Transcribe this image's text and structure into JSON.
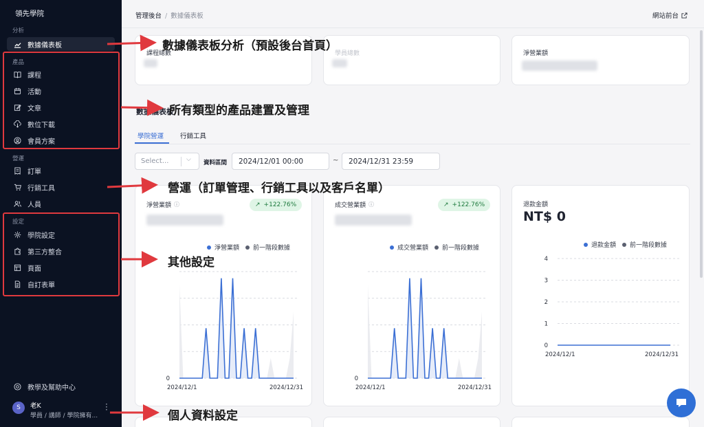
{
  "sidebar": {
    "brand": "領先學院",
    "sections": {
      "analysis": "分析",
      "products": "產品",
      "operations": "營運",
      "settings": "設定"
    },
    "items": {
      "dashboard": "數據儀表板",
      "courses": "課程",
      "events": "活動",
      "articles": "文章",
      "downloads": "數位下載",
      "membership": "會員方案",
      "orders": "訂單",
      "marketing": "行銷工具",
      "people": "人員",
      "school_settings": "學院設定",
      "integrations": "第三方整合",
      "pages": "頁面",
      "custom_forms": "自訂表單"
    },
    "help": "教學及幫助中心",
    "user": {
      "initial": "S",
      "name": "老K",
      "role": "學員 / 講師 / 學院擁有..."
    }
  },
  "topbar": {
    "breadcrumb_root": "管理後台",
    "breadcrumb_sep": "/",
    "breadcrumb_current": "數據儀表板",
    "front_link": "網站前台"
  },
  "summary_cards": {
    "courses": "課程總數",
    "students": "學員總數",
    "net_revenue": "淨營業額"
  },
  "dashboard": {
    "title": "數據儀表板",
    "tabs": [
      "學院營運",
      "行銷工具"
    ],
    "select_placeholder": "Select...",
    "range_label": "資料區間",
    "date_from": "2024/12/01 00:00",
    "date_to": "2024/12/31 23:59",
    "tilde": "~"
  },
  "charts_header": {
    "net": {
      "label": "淨營業額",
      "badge": "+122.76%",
      "legend_a": "淨營業額",
      "legend_b": "前一階段數據"
    },
    "deal": {
      "label": "成交營業額",
      "badge": "+122.76%",
      "legend_a": "成交營業額",
      "legend_b": "前一階段數據"
    },
    "refund": {
      "label": "退款金額",
      "value": "NT$ 0",
      "legend_a": "退款金額",
      "legend_b": "前一階段數據"
    }
  },
  "colors": {
    "primary": "#3b6fd4",
    "prev": "#5b6070",
    "annot_red": "#e0393e",
    "sidebar_bg": "#0b1222"
  },
  "chart_data": [
    {
      "type": "line",
      "title": "淨營業額",
      "x_ticks": [
        "2024/12/1",
        "2024/12/31"
      ],
      "y_ticks": [
        "0"
      ],
      "series": [
        {
          "name": "淨營業額",
          "values": [
            0,
            0,
            0,
            0,
            0,
            0,
            0,
            1.5,
            0,
            0,
            0,
            3,
            0,
            0,
            3,
            0,
            0,
            1.5,
            0,
            0,
            1.5,
            0,
            0,
            0,
            0,
            0,
            0,
            0,
            0,
            0,
            0
          ]
        },
        {
          "name": "前一階段數據",
          "values": [
            2.8,
            0,
            0,
            0,
            0,
            0,
            0,
            0,
            0,
            0,
            0,
            0,
            0,
            0,
            0,
            0,
            0,
            0,
            0,
            0,
            0,
            0,
            0,
            0,
            0.6,
            0,
            0,
            0,
            0,
            0.6,
            2
          ]
        }
      ]
    },
    {
      "type": "line",
      "title": "成交營業額",
      "x_ticks": [
        "2024/12/1",
        "2024/12/31"
      ],
      "y_ticks": [
        "0"
      ],
      "series": [
        {
          "name": "成交營業額",
          "values": [
            0,
            0,
            0,
            0,
            0,
            0,
            0,
            1.5,
            0,
            0,
            0,
            3,
            0,
            0,
            3,
            0,
            0,
            1.5,
            0,
            0,
            1.5,
            0,
            0,
            0,
            0,
            0,
            0,
            0,
            0,
            0,
            0
          ]
        },
        {
          "name": "前一階段數據",
          "values": [
            2.8,
            0,
            0,
            0,
            0,
            0,
            0,
            0,
            0,
            0,
            0,
            0,
            0,
            0,
            0,
            0,
            0,
            0,
            0,
            0,
            0,
            0,
            0,
            0,
            0.6,
            0,
            0,
            0,
            0,
            0.6,
            2
          ]
        }
      ]
    },
    {
      "type": "line",
      "title": "退款金額",
      "x_ticks": [
        "2024/12/1",
        "2024/12/31"
      ],
      "y_ticks": [
        "0",
        "1",
        "2",
        "3",
        "4"
      ],
      "ylim": [
        0,
        4
      ],
      "series": [
        {
          "name": "退款金額",
          "values": [
            0,
            0,
            0,
            0,
            0,
            0,
            0,
            0,
            0,
            0,
            0,
            0,
            0,
            0,
            0,
            0,
            0,
            0,
            0,
            0,
            0,
            0,
            0,
            0,
            0,
            0,
            0,
            0,
            0,
            0,
            0
          ]
        }
      ]
    }
  ],
  "annotations": {
    "a1": "數據儀表板分析（預設後台首頁）",
    "a2": "所有類型的產品建置及管理",
    "a3": "營運（訂單管理、行銷工具以及客戶名單）",
    "a4": "其他設定",
    "a5": "個人資料設定"
  }
}
